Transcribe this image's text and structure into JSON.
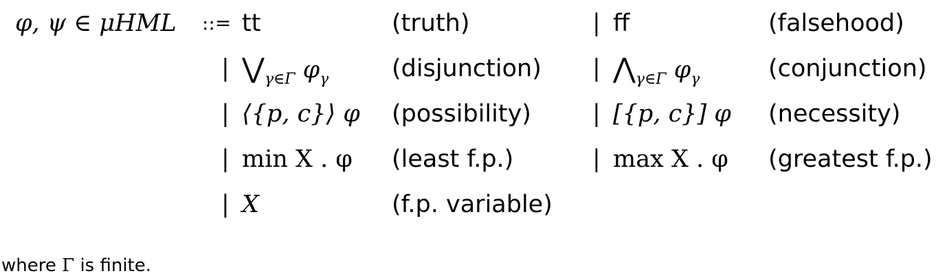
{
  "grammar": {
    "lhs": "φ, ψ ∈ μHML",
    "defsym": "::=",
    "sep": "|",
    "rows": [
      {
        "left": {
          "term": "tt",
          "label": "(truth)"
        },
        "right": {
          "term": "ff",
          "label": "(falsehood)"
        }
      },
      {
        "left": {
          "op": "⋁",
          "sub": "γ∈Γ",
          "body": "φ",
          "bodysub": "γ",
          "label": "(disjunction)"
        },
        "right": {
          "op": "⋀",
          "sub": "γ∈Γ",
          "body": "φ",
          "bodysub": "γ",
          "label": "(conjunction)"
        }
      },
      {
        "left": {
          "term": "⟨{p, c}⟩ φ",
          "label": "(possibility)"
        },
        "right": {
          "term": "[{p, c}] φ",
          "label": "(necessity)"
        }
      },
      {
        "left": {
          "term": "min X . φ",
          "label": "(least f.p.)"
        },
        "right": {
          "term": "max X . φ",
          "label": "(greatest f.p.)"
        }
      },
      {
        "left": {
          "term": "X",
          "label": "(f.p. variable)"
        }
      }
    ]
  },
  "footnote": {
    "prefix": "where",
    "symbol": "Γ",
    "suffix": "is finite."
  }
}
